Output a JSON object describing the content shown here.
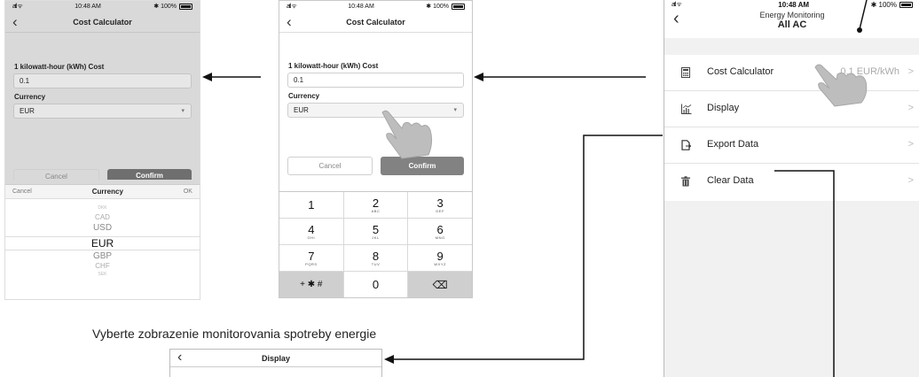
{
  "status_bar": {
    "signal": "atl ᯤ",
    "time": "10:48 AM",
    "battery": "✱ 100%"
  },
  "phone_picker": {
    "title": "Cost Calculator",
    "kwh_label": "1 kilowatt-hour (kWh) Cost",
    "kwh_value": "0.1",
    "currency_label": "Currency",
    "currency_value": "EUR",
    "cancel_label": "Cancel",
    "confirm_label": "Confirm",
    "picker_cancel": "Cancel",
    "picker_title": "Currency",
    "picker_ok": "OK",
    "options": [
      "DKK",
      "CAD",
      "USD",
      "EUR",
      "GBP",
      "CHF",
      "SEK"
    ]
  },
  "phone_input": {
    "title": "Cost Calculator",
    "kwh_label": "1 kilowatt-hour (kWh) Cost",
    "kwh_value": "0.1",
    "currency_label": "Currency",
    "currency_value": "EUR",
    "cancel_label": "Cancel",
    "confirm_label": "Confirm",
    "keypad": [
      {
        "n": "1",
        "l": ""
      },
      {
        "n": "2",
        "l": "ABC"
      },
      {
        "n": "3",
        "l": "DEF"
      },
      {
        "n": "4",
        "l": "GHI"
      },
      {
        "n": "5",
        "l": "JKL"
      },
      {
        "n": "6",
        "l": "MNO"
      },
      {
        "n": "7",
        "l": "PQRS"
      },
      {
        "n": "8",
        "l": "TUV"
      },
      {
        "n": "9",
        "l": "WXYZ"
      },
      {
        "n": "+ ✱ #",
        "l": ""
      },
      {
        "n": "0",
        "l": ""
      },
      {
        "n": "⌫",
        "l": ""
      }
    ]
  },
  "phone_settings": {
    "subtitle": "Energy Monitoring",
    "title": "All AC",
    "rows": [
      {
        "label": "Cost Calculator",
        "value": "0.1 EUR/kWh",
        "icon": "calculator-icon"
      },
      {
        "label": "Display",
        "value": "",
        "icon": "chart-icon"
      },
      {
        "label": "Export Data",
        "value": "",
        "icon": "export-icon"
      },
      {
        "label": "Clear Data",
        "value": "",
        "icon": "trash-icon"
      }
    ],
    "chevron": ">"
  },
  "caption": "Vyberte zobrazenie monitorovania spotreby energie",
  "phone_display": {
    "title": "Display"
  }
}
